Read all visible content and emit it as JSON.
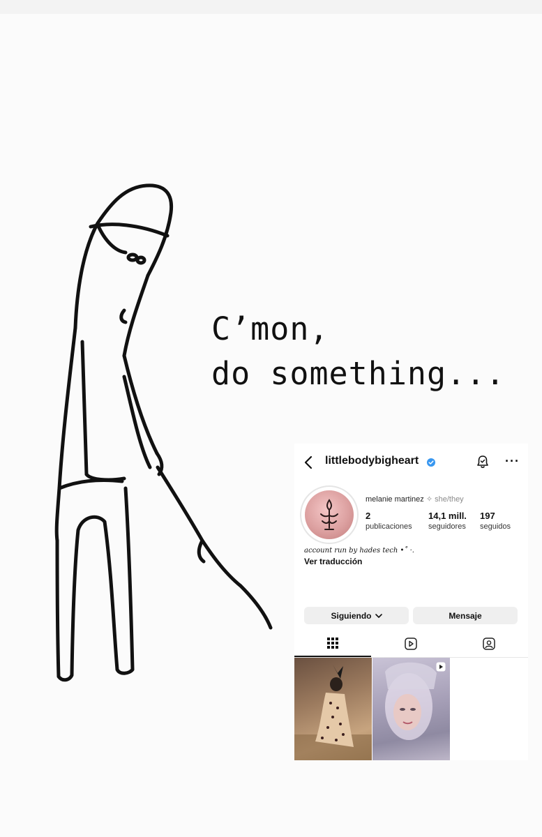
{
  "meme": {
    "caption_line1": "C’mon,",
    "caption_line2": "do something..."
  },
  "profile": {
    "username": "littlebodybigheart",
    "verified": true,
    "display_name": "melanie martinez",
    "pronouns": "✧ she/they",
    "stats": [
      {
        "value": "2",
        "label": "publicaciones"
      },
      {
        "value": "14,1 mill.",
        "label": "seguidores"
      },
      {
        "value": "197",
        "label": "seguidos"
      }
    ],
    "bio": "account run by hades tech •˚ ·.",
    "translate_label": "Ver traducción",
    "buttons": {
      "following": "Siguiendo",
      "message": "Mensaje"
    },
    "tabs": [
      "grid-icon",
      "reels-icon",
      "tagged-icon"
    ],
    "posts": [
      {
        "type": "photo",
        "icon": "none"
      },
      {
        "type": "reel",
        "icon": "reel-icon"
      }
    ],
    "colors": {
      "verified": "#3897f0",
      "button_bg": "#efefef"
    }
  }
}
